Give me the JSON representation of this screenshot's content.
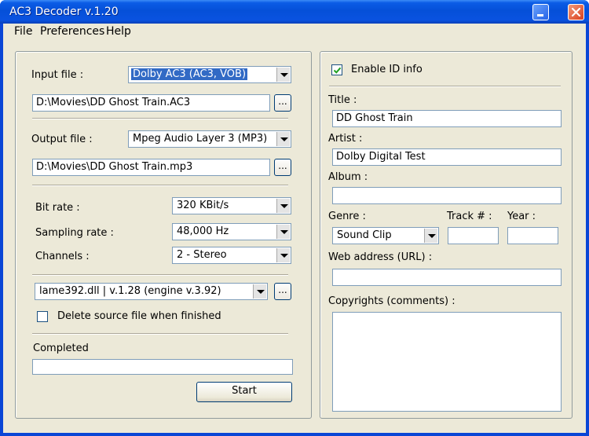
{
  "window": {
    "title": "AC3 Decoder v.1.20"
  },
  "menu": {
    "items": [
      "File",
      "Preferences",
      "Help"
    ]
  },
  "left": {
    "input_label": "Input file :",
    "input_format": "Dolby AC3 (AC3, VOB)",
    "input_path": "D:\\Movies\\DD Ghost Train.AC3",
    "browse_label": "...",
    "output_label": "Output file :",
    "output_format": "Mpeg Audio Layer 3 (MP3)",
    "output_path": "D:\\Movies\\DD Ghost Train.mp3",
    "bitrate_label": "Bit rate :",
    "bitrate_value": "320 KBit/s",
    "sampling_label": "Sampling rate :",
    "sampling_value": "48,000 Hz",
    "channels_label": "Channels :",
    "channels_value": "2 - Stereo",
    "engine_value": "lame392.dll | v.1.28 (engine v.3.92)",
    "delete_label": "Delete source file when finished",
    "delete_checked": false,
    "completed_label": "Completed",
    "progress_fraction": 0,
    "start_label": "Start"
  },
  "right": {
    "enable_label": "Enable ID info",
    "enable_checked": true,
    "title_label": "Title :",
    "title_value": "DD Ghost Train",
    "artist_label": "Artist :",
    "artist_value": "Dolby Digital Test",
    "album_label": "Album :",
    "album_value": "",
    "genre_label": "Genre :",
    "genre_value": "Sound Clip",
    "track_label": "Track # :",
    "track_value": "",
    "year_label": "Year :",
    "year_value": "",
    "url_label": "Web address (URL) :",
    "url_value": "",
    "copyrights_label": "Copyrights (comments) :",
    "copyrights_value": ""
  }
}
